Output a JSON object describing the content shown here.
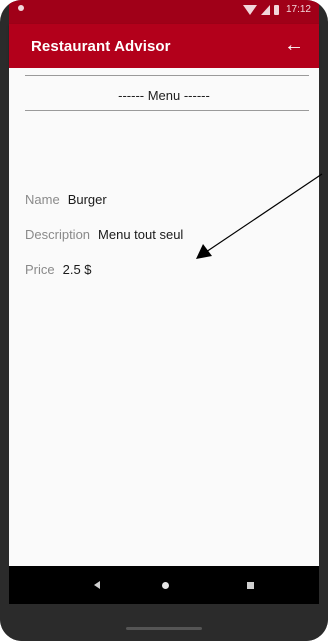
{
  "status_bar": {
    "time": "17:12"
  },
  "app_bar": {
    "title": "Restaurant Advisor",
    "back_glyph": "←"
  },
  "section": {
    "title": "------ Menu ------"
  },
  "fields": [
    {
      "label": "Name",
      "value": "Burger"
    },
    {
      "label": "Description",
      "value": "Menu tout seul"
    },
    {
      "label": "Price",
      "value": "2.5 $"
    }
  ],
  "colors": {
    "app_bar": "#b3001b",
    "status_bar": "#a00018",
    "background": "#fafafa",
    "label": "#8a8a8a",
    "value": "#1a1a1a"
  },
  "icons": {
    "status": [
      "wifi-icon",
      "signal-icon",
      "battery-icon"
    ],
    "nav": [
      "nav-back-icon",
      "nav-home-icon",
      "nav-recents-icon"
    ]
  }
}
